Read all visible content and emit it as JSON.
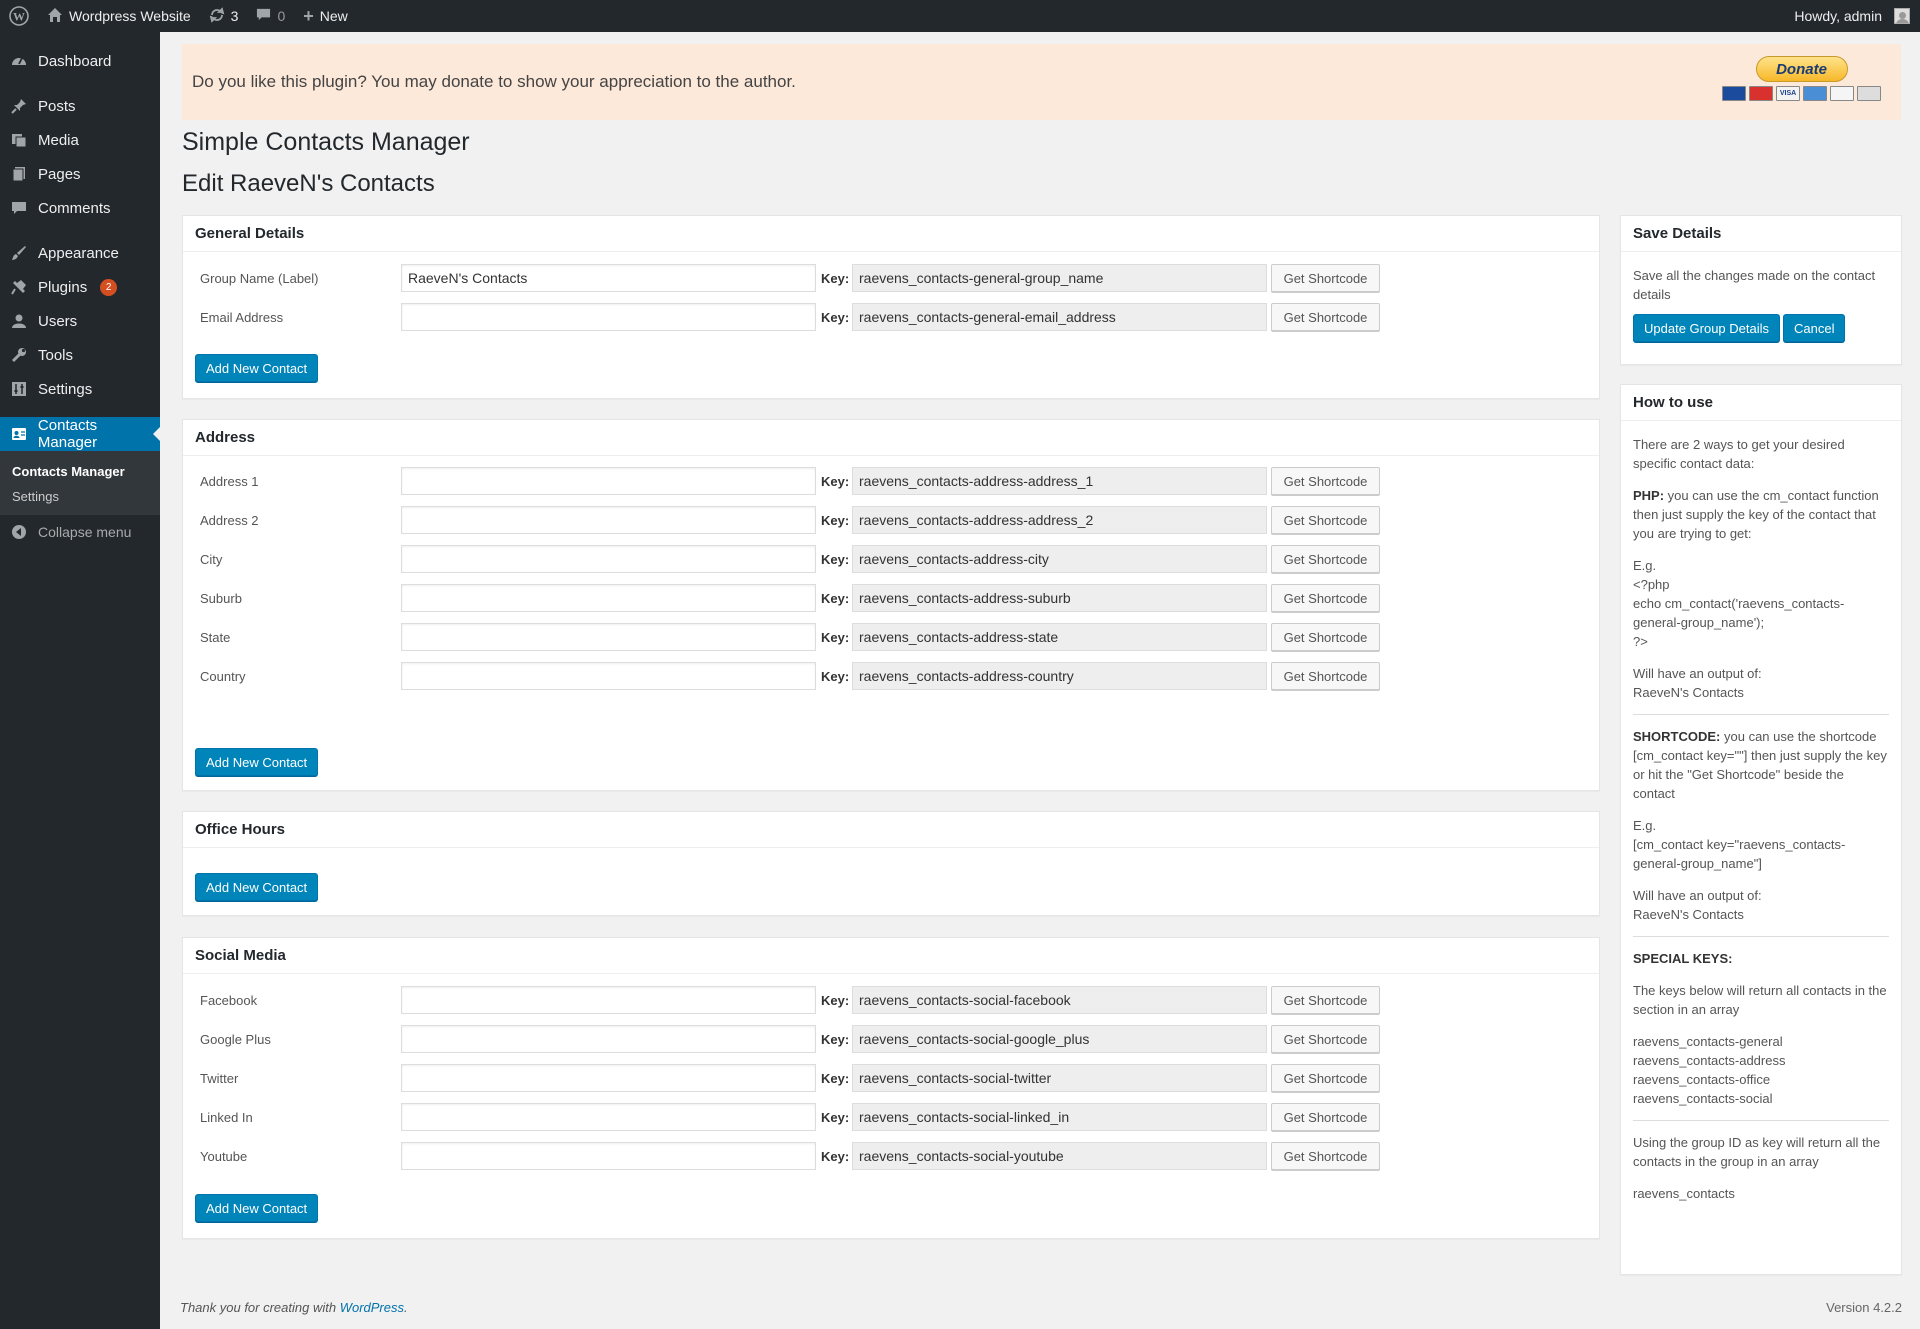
{
  "admin_bar": {
    "site_name": "Wordpress Website",
    "updates_count": "3",
    "comments_count": "0",
    "new_label": "New",
    "howdy": "Howdy, admin"
  },
  "sidebar": {
    "items": [
      {
        "label": "Dashboard",
        "icon": "dashboard-icon"
      },
      {
        "label": "Posts",
        "icon": "pin-icon"
      },
      {
        "label": "Media",
        "icon": "media-icon"
      },
      {
        "label": "Pages",
        "icon": "pages-icon"
      },
      {
        "label": "Comments",
        "icon": "comment-icon"
      },
      {
        "label": "Appearance",
        "icon": "brush-icon"
      },
      {
        "label": "Plugins",
        "icon": "plugin-icon",
        "badge": "2"
      },
      {
        "label": "Users",
        "icon": "user-icon"
      },
      {
        "label": "Tools",
        "icon": "wrench-icon"
      },
      {
        "label": "Settings",
        "icon": "settings-icon"
      },
      {
        "label": "Contacts Manager",
        "icon": "contacts-icon"
      }
    ],
    "submenu": [
      "Contacts Manager",
      "Settings"
    ],
    "collapse": "Collapse menu"
  },
  "notice": {
    "text": "Do you like this plugin? You may donate to show your appreciation to the author.",
    "donate_label": "Donate"
  },
  "page": {
    "title": "Simple Contacts Manager",
    "subtitle": "Edit RaeveN's Contacts"
  },
  "labels": {
    "key": "Key:",
    "get_shortcode": "Get Shortcode",
    "add_new_contact": "Add New Contact"
  },
  "sections": {
    "general": {
      "title": "General Details",
      "rows": [
        {
          "label": "Group Name (Label)",
          "value": "RaeveN's Contacts",
          "key": "raevens_contacts-general-group_name"
        },
        {
          "label": "Email Address",
          "value": "",
          "key": "raevens_contacts-general-email_address"
        }
      ]
    },
    "address": {
      "title": "Address",
      "rows": [
        {
          "label": "Address 1",
          "value": "",
          "key": "raevens_contacts-address-address_1"
        },
        {
          "label": "Address 2",
          "value": "",
          "key": "raevens_contacts-address-address_2"
        },
        {
          "label": "City",
          "value": "",
          "key": "raevens_contacts-address-city"
        },
        {
          "label": "Suburb",
          "value": "",
          "key": "raevens_contacts-address-suburb"
        },
        {
          "label": "State",
          "value": "",
          "key": "raevens_contacts-address-state"
        },
        {
          "label": "Country",
          "value": "",
          "key": "raevens_contacts-address-country"
        }
      ]
    },
    "office": {
      "title": "Office Hours"
    },
    "social": {
      "title": "Social Media",
      "rows": [
        {
          "label": "Facebook",
          "value": "",
          "key": "raevens_contacts-social-facebook"
        },
        {
          "label": "Google Plus",
          "value": "",
          "key": "raevens_contacts-social-google_plus"
        },
        {
          "label": "Twitter",
          "value": "",
          "key": "raevens_contacts-social-twitter"
        },
        {
          "label": "Linked In",
          "value": "",
          "key": "raevens_contacts-social-linked_in"
        },
        {
          "label": "Youtube",
          "value": "",
          "key": "raevens_contacts-social-youtube"
        }
      ]
    }
  },
  "save_box": {
    "title": "Save Details",
    "text": "Save all the changes made on the contact details",
    "update_label": "Update Group Details",
    "cancel_label": "Cancel"
  },
  "howto": {
    "title": "How to use",
    "intro": "There are 2 ways to get your desired specific contact data:",
    "php_label": "PHP:",
    "php_text": " you can use the cm_contact function then just supply the key of the contact that you are trying to get:",
    "php_eg": "E.g.",
    "php_code1": "<?php",
    "php_code2": "echo cm_contact('raevens_contacts-general-group_name');",
    "php_code3": "?>",
    "php_output_label": "Will have an output of:",
    "php_output": "RaeveN's Contacts",
    "sc_label": "SHORTCODE:",
    "sc_text": " you can use the shortcode [cm_contact key=\"\"] then just supply the key or hit the \"Get Shortcode\" beside the contact",
    "sc_eg": "E.g.",
    "sc_code": "[cm_contact key=\"raevens_contacts-general-group_name\"]",
    "sc_output_label": "Will have an output of:",
    "sc_output": "RaeveN's Contacts",
    "special_label": "SPECIAL KEYS:",
    "special_text": "The keys below will return all contacts in the section in an array",
    "special_keys": [
      "raevens_contacts-general",
      "raevens_contacts-address",
      "raevens_contacts-office",
      "raevens_contacts-social"
    ],
    "group_text": "Using the group ID as key will return all the contacts in the group in an array",
    "group_key": "raevens_contacts"
  },
  "footer": {
    "text": "Thank you for creating with ",
    "link": "WordPress",
    "end": ".",
    "version": "Version 4.2.2"
  },
  "colors": {
    "accent": "#0073aa",
    "sidebar_bg": "#23282d",
    "notice_bg": "#fde9da"
  }
}
